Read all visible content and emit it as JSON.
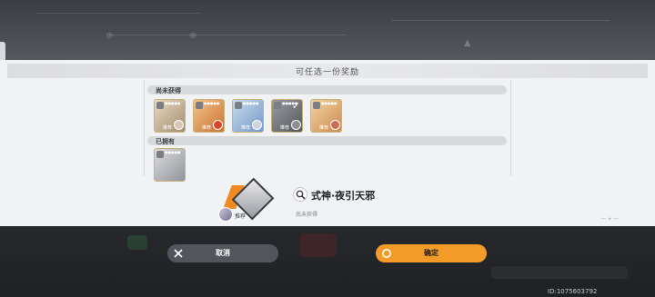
{
  "dialog": {
    "title": "可任选一份奖励",
    "section_unowned": "尚未获得",
    "section_owned": "已拥有"
  },
  "cards_unowned": [
    {
      "tag": "推荐",
      "palette": [
        "#e9d9c0",
        "#9d8a6c"
      ],
      "face": "#d9c6b7",
      "locked": false
    },
    {
      "tag": "推荐",
      "palette": [
        "#f1c48c",
        "#c96e2c"
      ],
      "face": "#d9442f",
      "locked": false
    },
    {
      "tag": "推荐",
      "palette": [
        "#c8dcef",
        "#6f94c2"
      ],
      "face": "#cfd3dd",
      "locked": false
    },
    {
      "tag": "推荐",
      "palette": [
        "#9a9ca1",
        "#4f5257"
      ],
      "face": "#8d8f94",
      "locked": true
    },
    {
      "tag": "推荐",
      "palette": [
        "#f3d3a2",
        "#c9884b"
      ],
      "face": "#c86e54",
      "locked": false
    }
  ],
  "cards_owned": [
    {
      "tag": "",
      "palette": [
        "#dcdcdf",
        "#8e9096"
      ],
      "face": "",
      "locked": false
    }
  ],
  "selected": {
    "name": "式神·夜引天邪",
    "status": "尚未获得",
    "tag": "推荐"
  },
  "buttons": {
    "cancel": "取消",
    "confirm": "确定"
  },
  "footer": {
    "uid": "ID:1075603792"
  },
  "colors": {
    "accent": "#f29b28",
    "cancel": "#52565c"
  },
  "icons": {
    "search": "magnifier-icon",
    "cancel": "x-icon",
    "confirm": "ring-icon"
  }
}
